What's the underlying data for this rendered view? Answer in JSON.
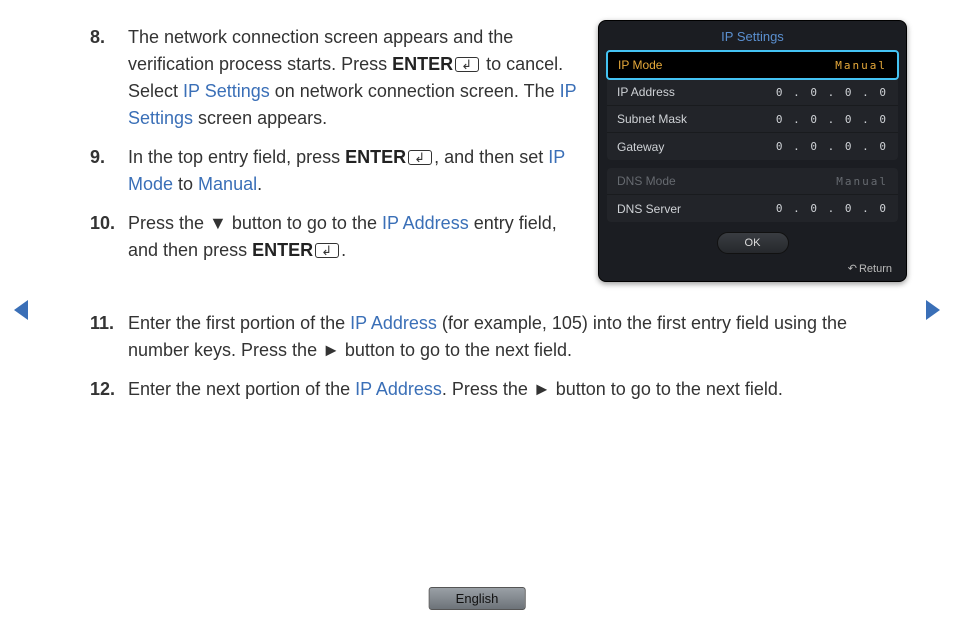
{
  "steps": {
    "s8": {
      "num": "8.",
      "t1": "The network connection screen appears and the verification process starts. Press ",
      "enter": "ENTER",
      "t2": " to cancel. Select ",
      "k1": "IP Settings",
      "t3": " on network connection screen. The ",
      "k2": "IP Settings",
      "t4": " screen appears."
    },
    "s9": {
      "num": "9.",
      "t1": "In the top entry field, press ",
      "enter": "ENTER",
      "t2": ", and then set ",
      "k1": "IP Mode",
      "t3": " to ",
      "k2": "Manual",
      "t4": "."
    },
    "s10": {
      "num": "10.",
      "t1": "Press the ▼ button to go to the ",
      "k1": "IP Address",
      "t2": " entry field, and then press ",
      "enter": "ENTER",
      "t3": "."
    },
    "s11": {
      "num": "11.",
      "t1": "Enter the first portion of the ",
      "k1": "IP Address",
      "t2": " (for example, 105) into the first entry field using the number keys. Press the ► button to go to the next field."
    },
    "s12": {
      "num": "12.",
      "t1": "Enter the next portion of the ",
      "k1": "IP Address",
      "t2": ". Press the ► button to go to the next field."
    }
  },
  "osd": {
    "title": "IP Settings",
    "rows": [
      {
        "label": "IP Mode",
        "value": "Manual",
        "selected": true
      },
      {
        "label": "IP Address",
        "value": "0 . 0 . 0 . 0"
      },
      {
        "label": "Subnet Mask",
        "value": "0 . 0 . 0 . 0"
      },
      {
        "label": "Gateway",
        "value": "0 . 0 . 0 . 0"
      }
    ],
    "rows2": [
      {
        "label": "DNS Mode",
        "value": "Manual",
        "dim": true
      },
      {
        "label": "DNS Server",
        "value": "0 . 0 . 0 . 0"
      }
    ],
    "ok": "OK",
    "return": "Return"
  },
  "footer": {
    "language": "English"
  }
}
